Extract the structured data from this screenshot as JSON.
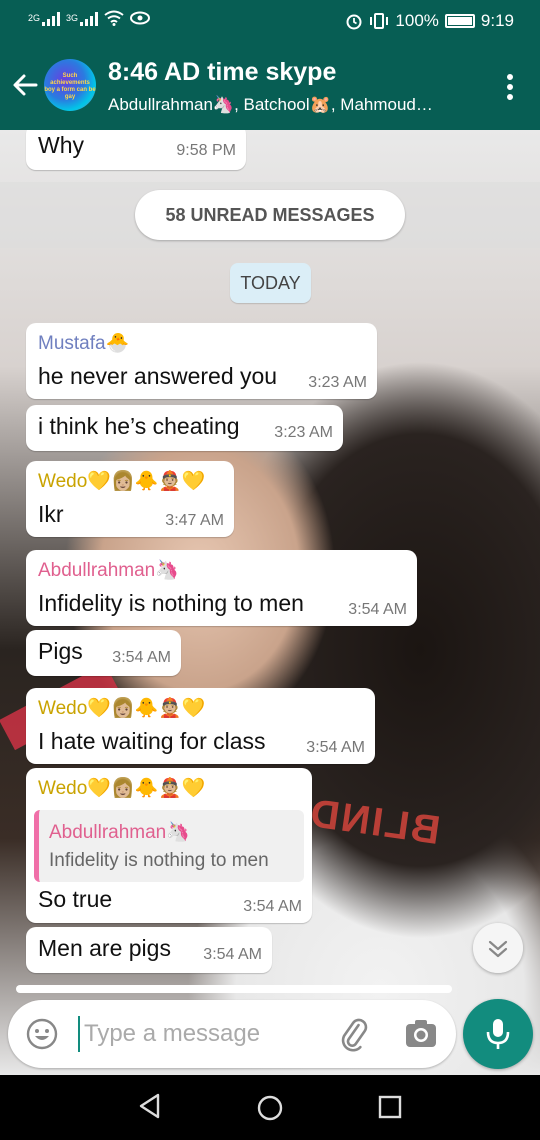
{
  "status_bar": {
    "network_a": "2G",
    "network_b": "3G",
    "battery": "100%",
    "time": "9:19"
  },
  "header": {
    "back_icon": "arrow-left-icon",
    "avatar_text": "Such achievements boy a form can be gay",
    "title": "8:46 AD time skype",
    "subtitle": "Abdullrahman🦄, Batchool🐹, Mahmoud…",
    "menu_icon": "vertical-dots-icon"
  },
  "chat": {
    "accent_color": "#075e54",
    "top_message": {
      "text": "Why",
      "time": "9:58 PM"
    },
    "unread_banner": "58 UNREAD MESSAGES",
    "date_chip": "TODAY",
    "messages": [
      {
        "sender": "Mustafa🐣",
        "sender_color": "#6f7fbf",
        "text": "he never answered you",
        "time": "3:23 AM"
      },
      {
        "sender": "",
        "text": "i think he’s cheating",
        "time": "3:23 AM"
      },
      {
        "sender": "Wedo💛👩🏼🐥👲🏼💛",
        "sender_color": "#c9a300",
        "text": "Ikr",
        "time": "3:47 AM"
      },
      {
        "sender": "Abdullrahman🦄",
        "sender_color": "#e0608f",
        "text": "Infidelity is nothing to men",
        "time": "3:54 AM"
      },
      {
        "sender": "",
        "text": "Pigs",
        "time": "3:54 AM"
      },
      {
        "sender": "Wedo💛👩🏼🐥👲🏼💛",
        "sender_color": "#c9a300",
        "text": "I hate waiting for class",
        "time": "3:54 AM"
      },
      {
        "sender": "Wedo💛👩🏼🐥👲🏼💛",
        "sender_color": "#c9a300",
        "quote_sender": "Abdullrahman🦄",
        "quote_text": "Infidelity is nothing to men",
        "text": "So true",
        "time": "3:54 AM"
      },
      {
        "sender": "",
        "text": "Men are pigs",
        "time": "3:54 AM"
      }
    ],
    "background_text": "BLIND"
  },
  "input_bar": {
    "placeholder": "Type a message",
    "emoji_icon": "emoji-icon",
    "attach_icon": "paperclip-icon",
    "camera_icon": "camera-icon",
    "mic_icon": "microphone-icon"
  },
  "nav": {
    "back_icon": "nav-back-icon",
    "home_icon": "nav-home-icon",
    "recents_icon": "nav-recents-icon"
  }
}
